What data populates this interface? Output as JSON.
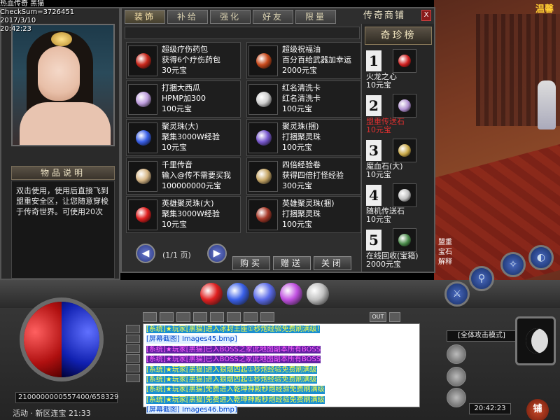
{
  "header": {
    "game_title": "热血传奇 黑猫",
    "checksum": "CheckSum=3726451",
    "date": "2017/3/10",
    "time": "20:42:23"
  },
  "top_banner": "温馨",
  "character_panel": {
    "description_title": "物品说明",
    "description_text": "双击使用，使用后直接飞到盟重安全区，让您随意穿梭于传奇世界。可使用20次"
  },
  "shop": {
    "title": "传奇商铺",
    "close_label": "X",
    "tabs": [
      {
        "label": "装饰"
      },
      {
        "label": "补给"
      },
      {
        "label": "强化"
      },
      {
        "label": "好友"
      },
      {
        "label": "限量"
      }
    ],
    "items": [
      {
        "name": "超级疗伤药包",
        "desc": "获得6个疗伤药包",
        "price": "30元宝",
        "color": "#c8281c"
      },
      {
        "name": "超级祝福油",
        "desc": "百分百给武器加幸运",
        "price": "2000元宝",
        "color": "#c84a1c"
      },
      {
        "name": "打捆大西瓜",
        "desc": "HPMP加300",
        "price": "100元宝",
        "color": "#c0a0e0"
      },
      {
        "name": "红名清洗卡",
        "desc": "红名清洗卡",
        "price": "100元宝",
        "color": "#d0d0d0"
      },
      {
        "name": "聚灵珠(大)",
        "desc": "聚集3000W经验",
        "price": "10元宝",
        "color": "#3a60e8"
      },
      {
        "name": "聚灵珠(捆)",
        "desc": "打捆聚灵珠",
        "price": "100元宝",
        "color": "#7a5ad0"
      },
      {
        "name": "千里传音",
        "desc": "输入@传不需要买我",
        "price": "100000000元宝",
        "color": "#d8b888"
      },
      {
        "name": "四倍经验卷",
        "desc": "获得四倍打怪经验",
        "price": "300元宝",
        "color": "#c8a868"
      },
      {
        "name": "英雄聚灵珠(大)",
        "desc": "聚集3000W经验",
        "price": "10元宝",
        "color": "#e02020"
      },
      {
        "name": "英雄聚灵珠(捆)",
        "desc": "打捆聚灵珠",
        "price": "100元宝",
        "color": "#a83a2a"
      }
    ],
    "pager": {
      "prev": "◀",
      "next": "▶",
      "page_text": "(1/1 页)"
    },
    "buy_label": "购买",
    "gift_label": "赠送",
    "close_btn_label": "关闭"
  },
  "rare": {
    "title": "奇珍榜",
    "items": [
      {
        "rank": "1",
        "name": "火龙之心",
        "price": "10元宝",
        "highlight": false,
        "color": "#d02020"
      },
      {
        "rank": "2",
        "name": "盟重传送石",
        "price": "10元宝",
        "highlight": true,
        "color": "#b090d0"
      },
      {
        "rank": "3",
        "name": "魔血石(大)",
        "price": "10元宝",
        "highlight": false,
        "color": "#c8a848"
      },
      {
        "rank": "4",
        "name": "随机传送石",
        "price": "10元宝",
        "highlight": false,
        "color": "#c0c0c0"
      },
      {
        "rank": "5",
        "name": "在线回收(宝箱)",
        "price": "2000元宝",
        "highlight": false,
        "color": "#4a8a4a"
      }
    ]
  },
  "hud": {
    "exp": "2100000000557400/658329",
    "status": "活动 · 新区连宝 21:33",
    "attack_mode": "[全体攻击模式]",
    "clock": "20:42:23",
    "shop_key": "铺",
    "belt_colors": [
      "#e02020",
      "#3a60e8",
      "#5a6ae8",
      "#c050e0",
      "#c0c0c0"
    ]
  },
  "chat": {
    "toolbar": [
      "OUT"
    ],
    "lines": [
      {
        "type": "sys-c",
        "text": "[系统]★玩家[黑猫]进入冰封王座①秒炮经验免费刷满级!"
      },
      {
        "type": "shot",
        "text": "[屏幕截图] Images45.bmp]"
      },
      {
        "type": "sys-p",
        "text": "[系统]★玩家[黑猫]已入BOSS之家此地图副本所有BOSS"
      },
      {
        "type": "sys-p",
        "text": "[系统]★玩家[黑猫]已入BOSS之家此地图副本所有BOSS"
      },
      {
        "type": "sys-c",
        "text": "[系统]★玩家[黑猫]进入狼烟四起①秒炮经验免费刷满级"
      },
      {
        "type": "sys-c",
        "text": "[系统]★玩家[黑猫]进入狼烟四起①秒炮经验免费刷满级"
      },
      {
        "type": "sys-c",
        "text": "[系统]★玩家[黑猫]免费进入乾坤神殿秒炮经验免费刷满级"
      },
      {
        "type": "sys-c",
        "text": "[系统]★玩家[黑猫]免费进入乾坤神殿秒炮经验免费刷满级"
      },
      {
        "type": "shot",
        "text": "[屏幕截图] Images46.bmp]"
      }
    ]
  },
  "side_tags": [
    "盟重",
    "宝石",
    "解释"
  ]
}
